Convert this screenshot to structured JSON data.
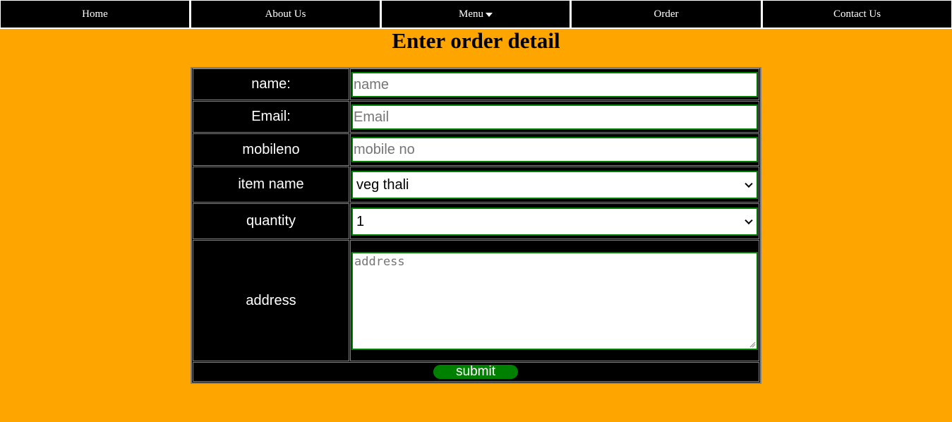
{
  "nav": {
    "home": "Home",
    "about": "About Us",
    "menu": "Menu",
    "order": "Order",
    "contact": "Contact Us"
  },
  "page": {
    "title": "Enter order detail"
  },
  "form": {
    "name_label": "name:",
    "name_placeholder": "name",
    "email_label": "Email:",
    "email_placeholder": "Email",
    "mobile_label": "mobileno",
    "mobile_placeholder": "mobile no",
    "item_label": "item name",
    "item_value": "veg thali",
    "quantity_label": "quantity",
    "quantity_value": "1",
    "address_label": "address",
    "address_placeholder": "address",
    "submit_label": "submit"
  },
  "colors": {
    "background": "#ffa500",
    "nav_background": "#000000",
    "form_background": "#000000",
    "field_border": "#008000",
    "submit_background": "#008000"
  },
  "icons": {
    "menu_caret": "caret-down-icon",
    "select_arrow": "chevron-down-icon",
    "textarea_resize": "resize-handle-icon"
  }
}
